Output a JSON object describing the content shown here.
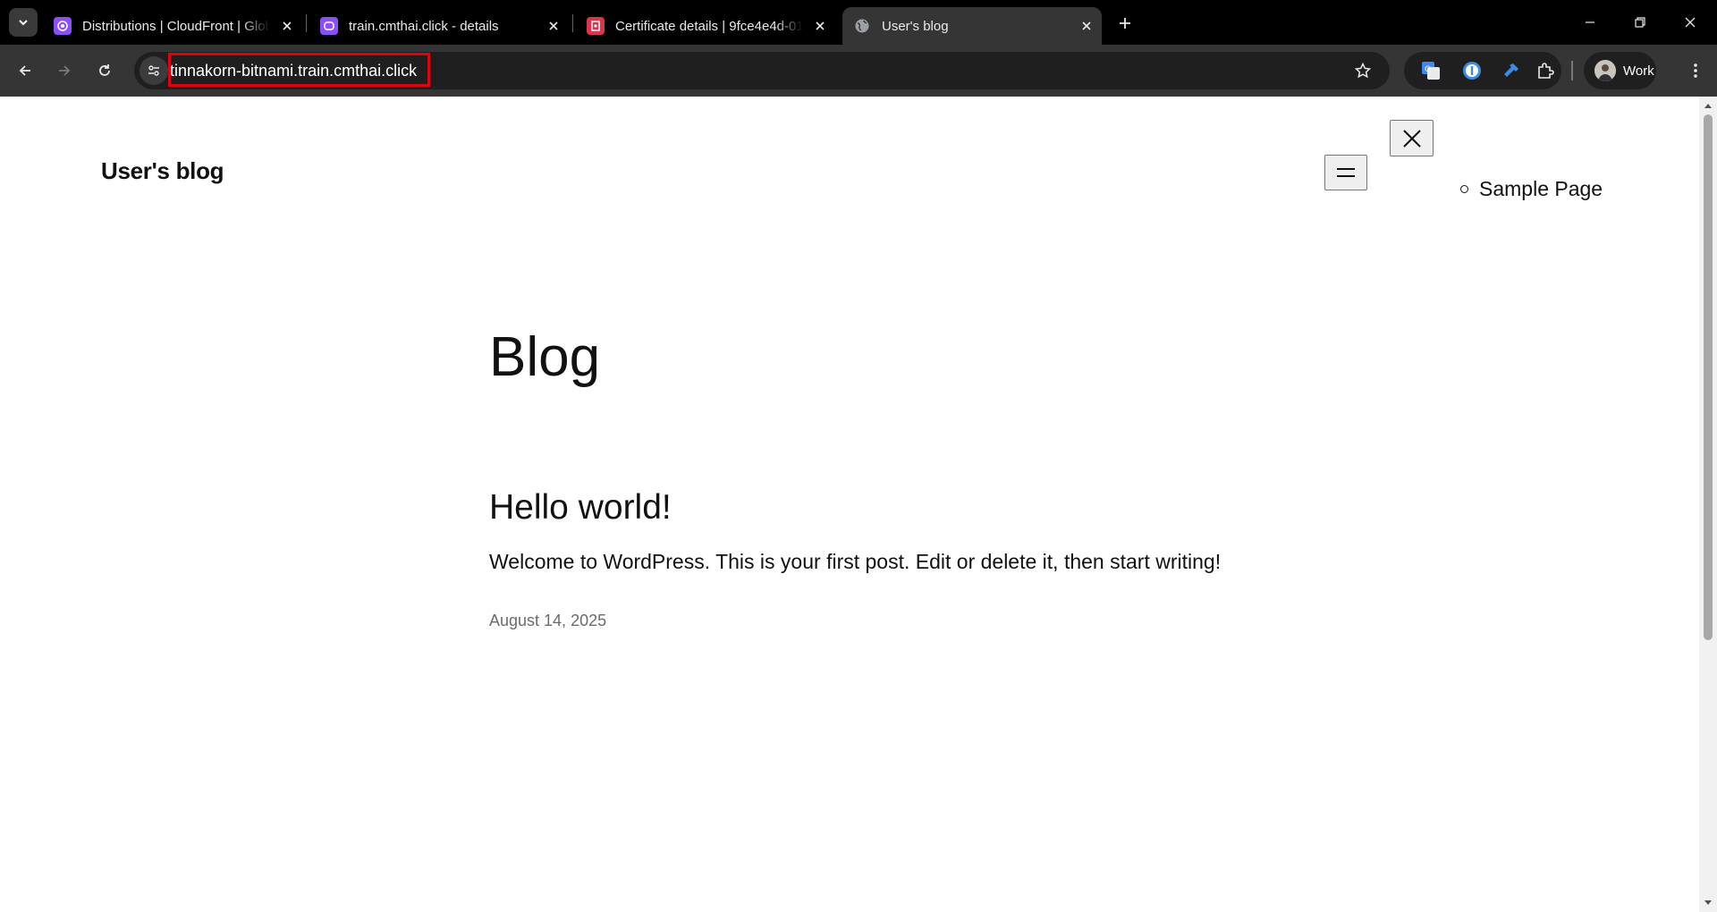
{
  "browser": {
    "tabs": [
      {
        "title": "Distributions | CloudFront | Global",
        "favicon": "cloudfront-icon",
        "favicon_color": "#8c4fff"
      },
      {
        "title": "train.cmthai.click - details",
        "favicon": "route53-icon",
        "favicon_color": "#8c4fff"
      },
      {
        "title": "Certificate details | 9fce4e4d-01",
        "favicon": "acm-icon",
        "favicon_color": "#dd344c"
      },
      {
        "title": "User's blog",
        "favicon": "globe-icon",
        "active": true
      }
    ],
    "address_bar": {
      "url": "tinnakorn-bitnami.train.cmthai.click"
    },
    "profile": {
      "label": "Work"
    },
    "extensions": [
      "google-translate-icon",
      "password-manager-icon",
      "wrench-extension-icon",
      "extensions-puzzle-icon"
    ]
  },
  "page": {
    "site_title": "User's blog",
    "nav": {
      "items": [
        "Sample Page"
      ]
    },
    "heading": "Blog",
    "post": {
      "title": "Hello world!",
      "excerpt": "Welcome to WordPress. This is your first post. Edit or delete it, then start writing!",
      "date": "August 14, 2025"
    }
  },
  "colors": {
    "chrome_dark": "#000000",
    "toolbar": "#353535",
    "highlight_box": "#e3000f",
    "text": "#111111",
    "date_text": "#6b6b6b"
  }
}
